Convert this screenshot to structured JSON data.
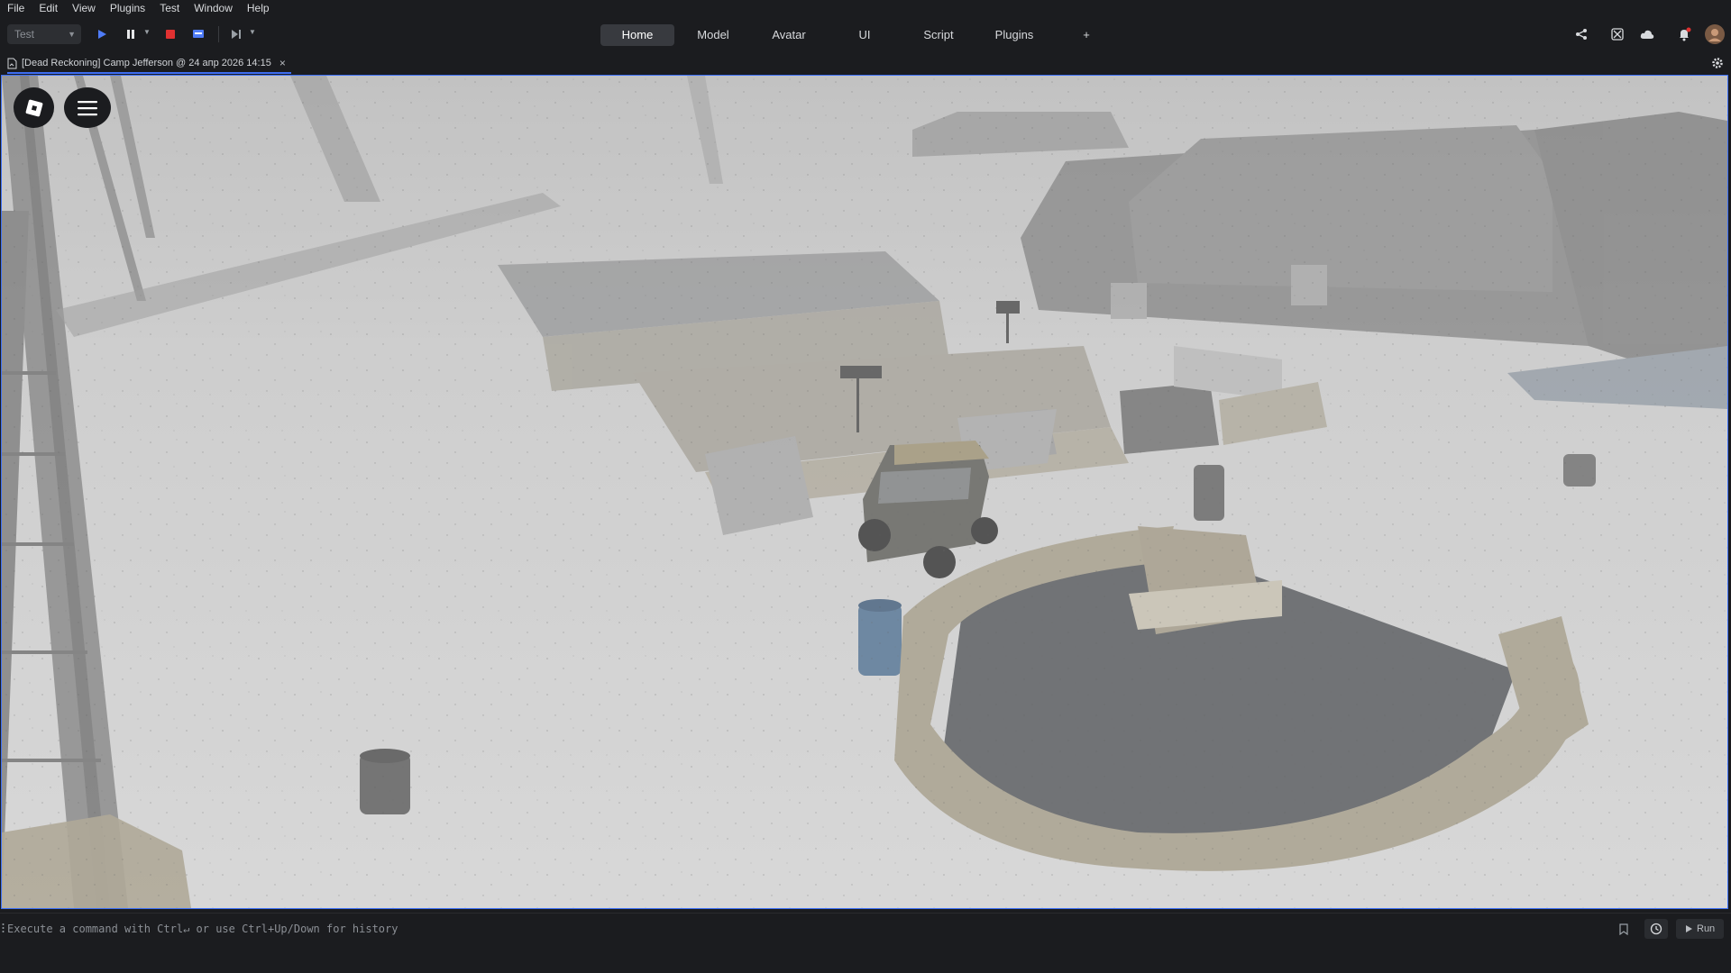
{
  "menu": [
    "File",
    "Edit",
    "View",
    "Plugins",
    "Test",
    "Window",
    "Help"
  ],
  "toolbar": {
    "mode_value": "Test",
    "tabs": [
      "Home",
      "Model",
      "Avatar",
      "UI",
      "Script",
      "Plugins",
      "+"
    ],
    "active_tab": "Home"
  },
  "document_tab": {
    "title": "[Dead Reckoning] Camp Jefferson @ 24 апр 2026 14:15",
    "close_glyph": "×"
  },
  "command_bar": {
    "placeholder": "Execute a command with Ctrl↵ or use Ctrl+Up/Down for history",
    "run_label": "Run"
  },
  "icons": {
    "play": "play-icon",
    "pause": "pause-icon",
    "stop": "stop-icon",
    "screen": "client-server-icon",
    "step": "step-forward-icon",
    "share": "share-icon",
    "collab": "team-create-icon",
    "cloud": "cloud-icon",
    "bell": "notification-bell-icon",
    "avatar": "user-avatar",
    "settings": "gear-icon",
    "roblox": "roblox-logo-icon",
    "menu": "hamburger-menu-icon",
    "bookmark": "bookmark-icon",
    "history": "history-icon"
  },
  "colors": {
    "accent": "#3d6df2",
    "stop": "#e03131",
    "play": "#4f7cf7",
    "background": "#1b1c1f"
  }
}
